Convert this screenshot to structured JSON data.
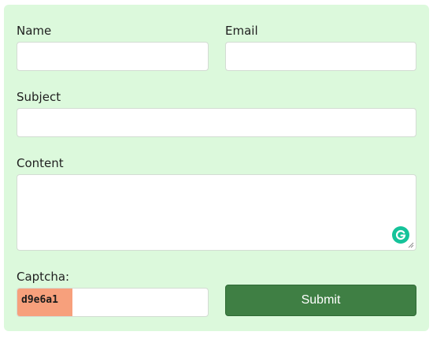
{
  "form": {
    "name": {
      "label": "Name",
      "value": "",
      "placeholder": ""
    },
    "email": {
      "label": "Email",
      "value": "",
      "placeholder": ""
    },
    "subject": {
      "label": "Subject",
      "value": "",
      "placeholder": ""
    },
    "content": {
      "label": "Content",
      "value": "",
      "placeholder": ""
    },
    "captcha": {
      "label": "Captcha:",
      "code": "d9e6a1",
      "value": ""
    },
    "submit_label": "Submit"
  },
  "colors": {
    "card_background": "#dcf9dc",
    "captcha_background": "#f7a07c",
    "submit_background": "#3f7f44",
    "grammarly_green": "#15c39a"
  },
  "icons": {
    "content_field_badge": "grammarly-icon",
    "textarea_corner": "resize-grip-icon"
  }
}
